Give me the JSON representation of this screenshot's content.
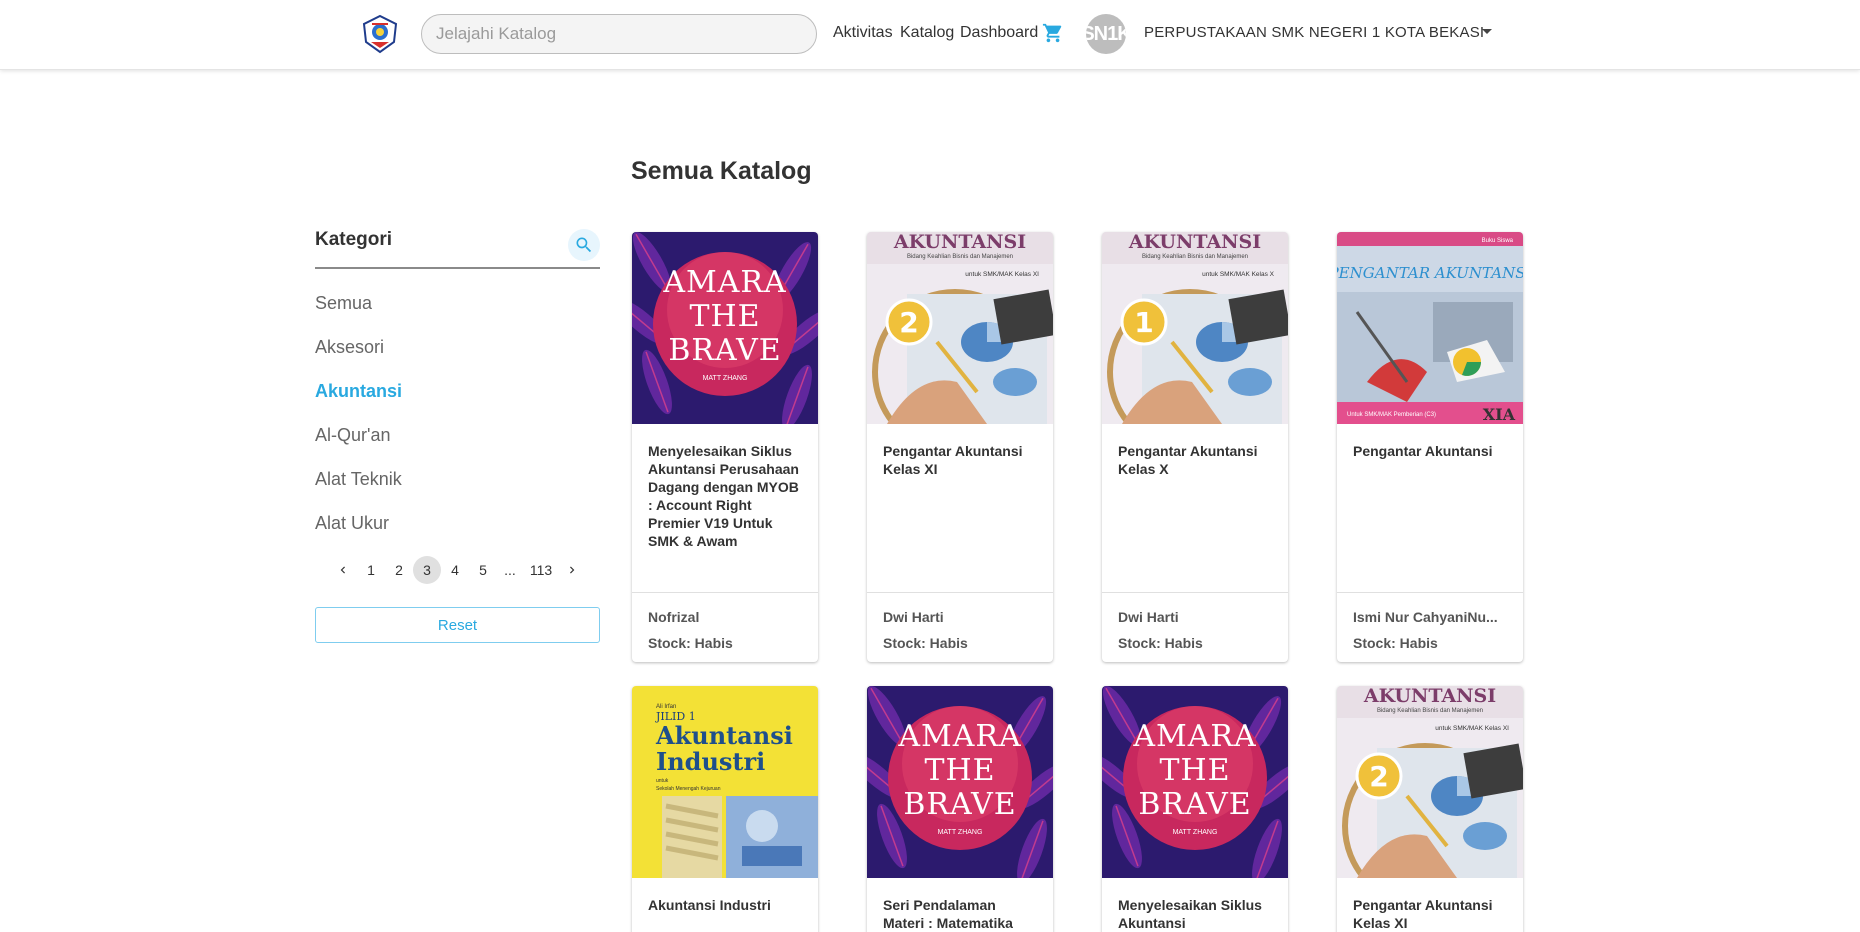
{
  "header": {
    "search_placeholder": "Jelajahi Katalog",
    "nav": [
      "Aktivitas",
      "Katalog",
      "Dashboard"
    ],
    "avatar_initials": "SN1K",
    "org_name": "PERPUSTAKAAN SMK NEGERI 1 KOTA BEKASI"
  },
  "page_title": "Semua Katalog",
  "sidebar": {
    "heading": "Kategori",
    "items": [
      {
        "label": "Semua",
        "active": false
      },
      {
        "label": "Aksesori",
        "active": false
      },
      {
        "label": "Akuntansi",
        "active": true
      },
      {
        "label": "Al-Qur'an",
        "active": false
      },
      {
        "label": "Alat Teknik",
        "active": false
      },
      {
        "label": "Alat Ukur",
        "active": false
      }
    ],
    "pagination": {
      "pages": [
        "1",
        "2",
        "3",
        "4",
        "5",
        "...",
        "113"
      ],
      "current": "3"
    },
    "reset_label": "Reset"
  },
  "books": [
    {
      "title": "Menyelesaikan Siklus Akuntansi Perusahaan Dagang dengan MYOB : Account Right Premier V19 Untuk SMK & Awam",
      "author": "Nofrizal",
      "stock": "Stock: Habis",
      "cover": "amara"
    },
    {
      "title": "Pengantar Akuntansi Kelas XI",
      "author": "Dwi Harti",
      "stock": "Stock: Habis",
      "cover": "akuntansi2"
    },
    {
      "title": "Pengantar Akuntansi Kelas X",
      "author": "Dwi Harti",
      "stock": "Stock: Habis",
      "cover": "akuntansi1"
    },
    {
      "title": "Pengantar Akuntansi",
      "author": "Ismi Nur CahyaniNu...",
      "stock": "Stock: Habis",
      "cover": "pengantar"
    },
    {
      "title": "Akuntansi Industri",
      "author": "",
      "stock": "",
      "cover": "industri"
    },
    {
      "title": "Seri Pendalaman Materi : Matematika",
      "author": "",
      "stock": "",
      "cover": "amara"
    },
    {
      "title": "Menyelesaikan Siklus Akuntansi",
      "author": "",
      "stock": "",
      "cover": "amara"
    },
    {
      "title": "Pengantar Akuntansi Kelas XI",
      "author": "",
      "stock": "",
      "cover": "akuntansi2"
    }
  ],
  "covers": {
    "amara": {
      "line1": "AMARA",
      "line2": "THE",
      "line3": "BRAVE",
      "byline": "MATT ZHANG"
    },
    "akuntansi": {
      "title": "AKUNTANSI",
      "sub": "Bidang Keahlian Bisnis dan Manajemen",
      "grade_xi": "untuk SMK/MAK Kelas XI",
      "grade_x": "untuk SMK/MAK Kelas X",
      "num2": "2",
      "num1": "1"
    },
    "pengantar": {
      "title": "PENGANTAR AKUNTANSI",
      "tag": "Buku Siswa",
      "badge": "XIA",
      "foot": "Untuk SMK/MAK Pemberian (C3)"
    },
    "industri": {
      "author": "Ali Irfan",
      "jilid": "JILID 1",
      "line1": "Akuntansi",
      "line2": "Industri",
      "sub1": "untuk",
      "sub2": "Sekolah Menengah Kejuruan"
    }
  },
  "colors": {
    "accent": "#29a9e0",
    "cart": "#29a9e0"
  }
}
